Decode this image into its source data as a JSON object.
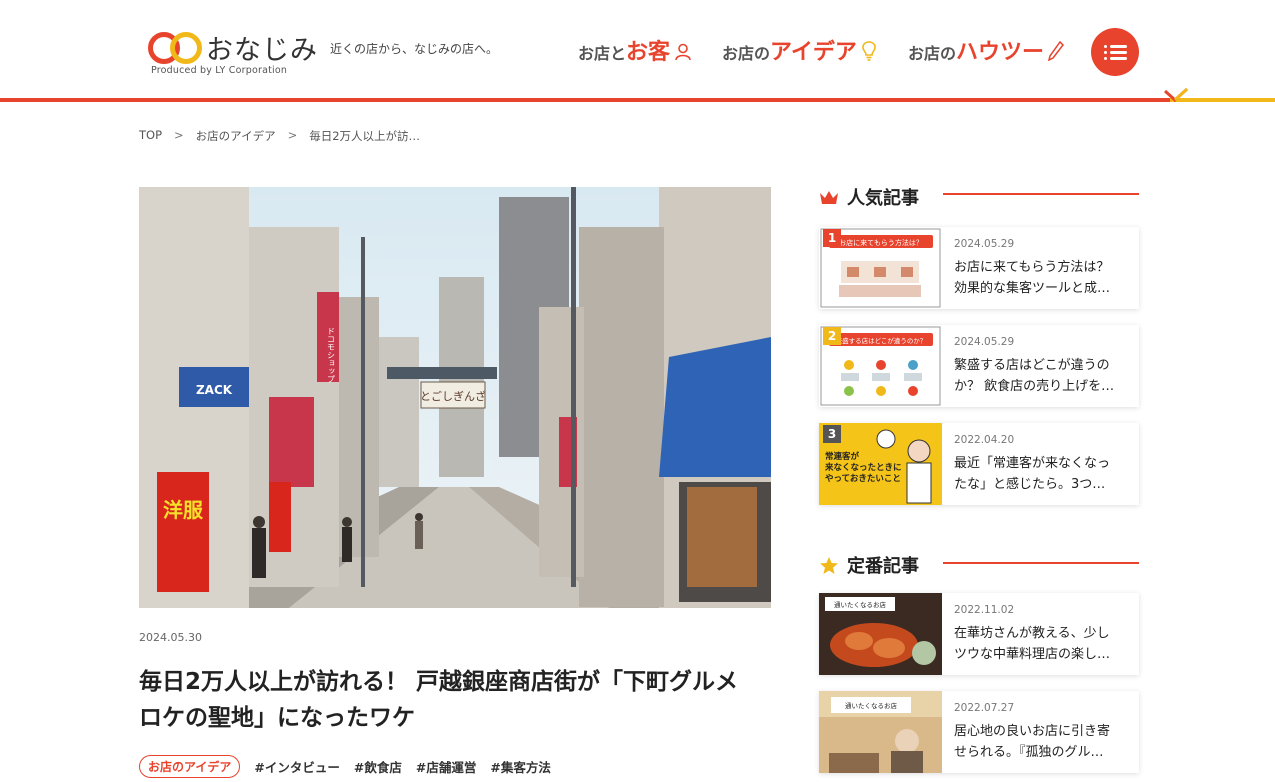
{
  "header": {
    "logo_name": "おなじみ",
    "tagline": "近くの店から、なじみの店へ。",
    "produced_by": "Produced by LY Corporation",
    "nav": [
      {
        "prefix": "お店と",
        "big": "お客",
        "icon": "person-icon"
      },
      {
        "prefix": "お店の",
        "big": "アイデア",
        "icon": "lightbulb-icon"
      },
      {
        "prefix": "お店の",
        "big": "ハウツー",
        "icon": "pencil-icon"
      }
    ],
    "menu_icon": "menu-list-icon"
  },
  "breadcrumb": [
    "TOP",
    "お店のアイデア",
    "毎日2万人以上が訪…"
  ],
  "breadcrumb_sep": ">",
  "article": {
    "date": "2024.05.30",
    "title_line1": "毎日2万人以上が訪れる！ 戸越銀座商店街が「下町グルメ",
    "title_line2": "ロケの聖地」になったワケ",
    "category": "お店のアイデア",
    "tags": [
      "#インタビュー",
      "#飲食店",
      "#店舗運営",
      "#集客方法"
    ],
    "hero_texts": {
      "arch": "とごしぎんざ",
      "sign_zack": "ZACK",
      "sign_docomo": "ドコモショップ",
      "banner": "洋服"
    }
  },
  "popular": {
    "title": "人気記事",
    "icon": "crown-icon",
    "items": [
      {
        "rank": "1",
        "date": "2024.05.29",
        "line1": "お店に来てもらう方法は？",
        "line2": "効果的な集客ツールと成…",
        "thumb_text": "お店に来てもらう方法は？"
      },
      {
        "rank": "2",
        "date": "2024.05.29",
        "line1": "繁盛する店はどこが違うの",
        "line2": "か？ 飲食店の売り上げを…",
        "thumb_text": "繁盛する店はどこが違うのか？"
      },
      {
        "rank": "3",
        "date": "2022.04.20",
        "line1": "最近「常連客が来なくなっ",
        "line2": "たな」と感じたら。3つ…",
        "thumb_text_1": "常連客が",
        "thumb_text_2": "来なくなったときに",
        "thumb_text_3": "やっておきたいこと"
      }
    ]
  },
  "standard": {
    "title": "定番記事",
    "icon": "star-icon",
    "items": [
      {
        "date": "2022.11.02",
        "line1": "在華坊さんが教える、少し",
        "line2": "ツウな中華料理店の楽し…",
        "thumb_text": "通いたくなるお店"
      },
      {
        "date": "2022.07.27",
        "line1": "居心地の良いお店に引き寄",
        "line2": "せられる。『孤独のグル…",
        "thumb_text": "通いたくなるお店"
      }
    ]
  },
  "colors": {
    "accent": "#e8432d",
    "yellow": "#f0b818"
  }
}
